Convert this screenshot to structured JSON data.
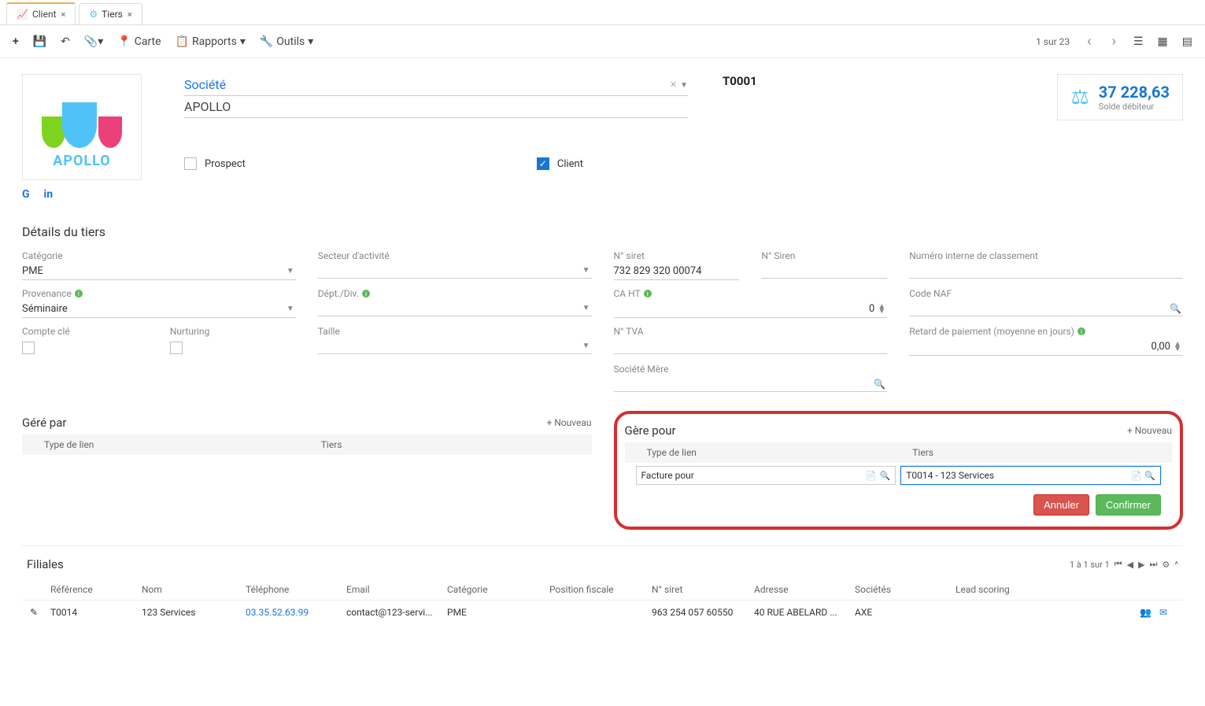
{
  "tabs": [
    {
      "label": "Client",
      "active": true,
      "icon": "chart"
    },
    {
      "label": "Tiers",
      "active": false,
      "icon": "gear"
    }
  ],
  "toolbar": {
    "carte": "Carte",
    "rapports": "Rapports",
    "outils": "Outils",
    "pager": "1 sur 23"
  },
  "header": {
    "logo_text": "APOLLO",
    "societe_label": "Société",
    "name": "APOLLO",
    "code": "T0001",
    "prospect_label": "Prospect",
    "prospect_checked": false,
    "client_label": "Client",
    "client_checked": true,
    "balance_value": "37 228,63",
    "balance_label": "Solde débiteur"
  },
  "details": {
    "title": "Détails du tiers",
    "categorie_label": "Catégorie",
    "categorie_value": "PME",
    "secteur_label": "Secteur d'activité",
    "secteur_value": "",
    "siret_label": "N° siret",
    "siret_value": "732 829 320 00074",
    "siren_label": "N° Siren",
    "siren_value": "",
    "numinterne_label": "Numéro interne de classement",
    "provenance_label": "Provenance",
    "provenance_value": "Séminaire",
    "dept_label": "Dépt./Div.",
    "caht_label": "CA HT",
    "caht_value": "0",
    "codenaf_label": "Code NAF",
    "compte_label": "Compte clé",
    "nurturing_label": "Nurturing",
    "taille_label": "Taille",
    "tva_label": "N° TVA",
    "retard_label": "Retard de paiement (moyenne en jours)",
    "retard_value": "0,00",
    "societe_mere_label": "Société Mère"
  },
  "gere_par": {
    "title": "Géré par",
    "nouveau": "Nouveau",
    "col_type": "Type de lien",
    "col_tiers": "Tiers"
  },
  "gere_pour": {
    "title": "Gère pour",
    "nouveau": "Nouveau",
    "col_type": "Type de lien",
    "col_tiers": "Tiers",
    "type_value": "Facture pour",
    "tiers_value": "T0014 - 123 Services",
    "btn_cancel": "Annuler",
    "btn_confirm": "Confirmer"
  },
  "filiales": {
    "title": "Filiales",
    "pager": "1 à 1 sur 1",
    "cols": {
      "ref": "Référence",
      "nom": "Nom",
      "tel": "Téléphone",
      "email": "Email",
      "cat": "Catégorie",
      "pos": "Position fiscale",
      "siret": "N° siret",
      "adr": "Adresse",
      "soc": "Sociétés",
      "lead": "Lead scoring"
    },
    "rows": [
      {
        "ref": "T0014",
        "nom": "123 Services",
        "tel": "03.35.52.63.99",
        "email": "contact@123-servi...",
        "cat": "PME",
        "pos": "",
        "siret": "963 254 057 60550",
        "adr": "40 RUE ABELARD ...",
        "soc": "AXE",
        "lead": ""
      }
    ]
  }
}
